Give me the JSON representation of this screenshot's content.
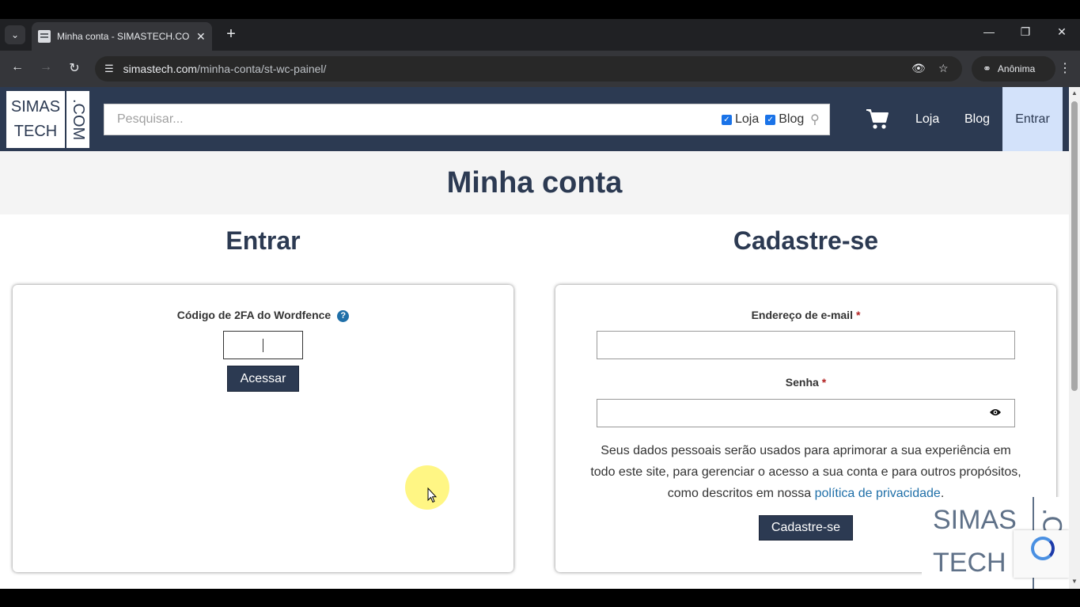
{
  "browser": {
    "tab_title": "Minha conta - SIMASTECH.COM",
    "tab_close": "✕",
    "new_tab": "+",
    "url_host": "simastech.com",
    "url_path": "/minha-conta/st-wc-painel/",
    "profile_label": "Anônima",
    "window_minimize": "—",
    "window_restore": "❐",
    "window_close": "✕"
  },
  "header": {
    "logo_line1": "SIMAS",
    "logo_line2": "TECH",
    "logo_vertical": ".COM",
    "search_placeholder": "Pesquisar...",
    "filter_loja": "Loja",
    "filter_blog": "Blog",
    "nav": {
      "loja": "Loja",
      "blog": "Blog",
      "entrar": "Entrar"
    }
  },
  "page": {
    "title": "Minha conta"
  },
  "login": {
    "heading": "Entrar",
    "code_label": "Código de 2FA do Wordfence",
    "help_glyph": "?",
    "code_value": "",
    "submit_label": "Acessar"
  },
  "register": {
    "heading": "Cadastre-se",
    "email_label": "Endereço de e-mail",
    "password_label": "Senha",
    "required_mark": "*",
    "privacy_text": "Seus dados pessoais serão usados para aprimorar a sua experiência em todo este site, para gerenciar o acesso a sua conta e para outros propósitos, como descritos em nossa ",
    "privacy_link": "política de privacidade",
    "privacy_end": ".",
    "submit_label": "Cadastre-se"
  },
  "watermark": {
    "line1": "SIMAS",
    "line2": "TECH",
    "vertical": ".COM"
  },
  "colors": {
    "brand_navy": "#2c3a52",
    "nav_active_bg": "#d3e2fa",
    "link_blue": "#1f6fa8",
    "required_red": "#b22222"
  }
}
